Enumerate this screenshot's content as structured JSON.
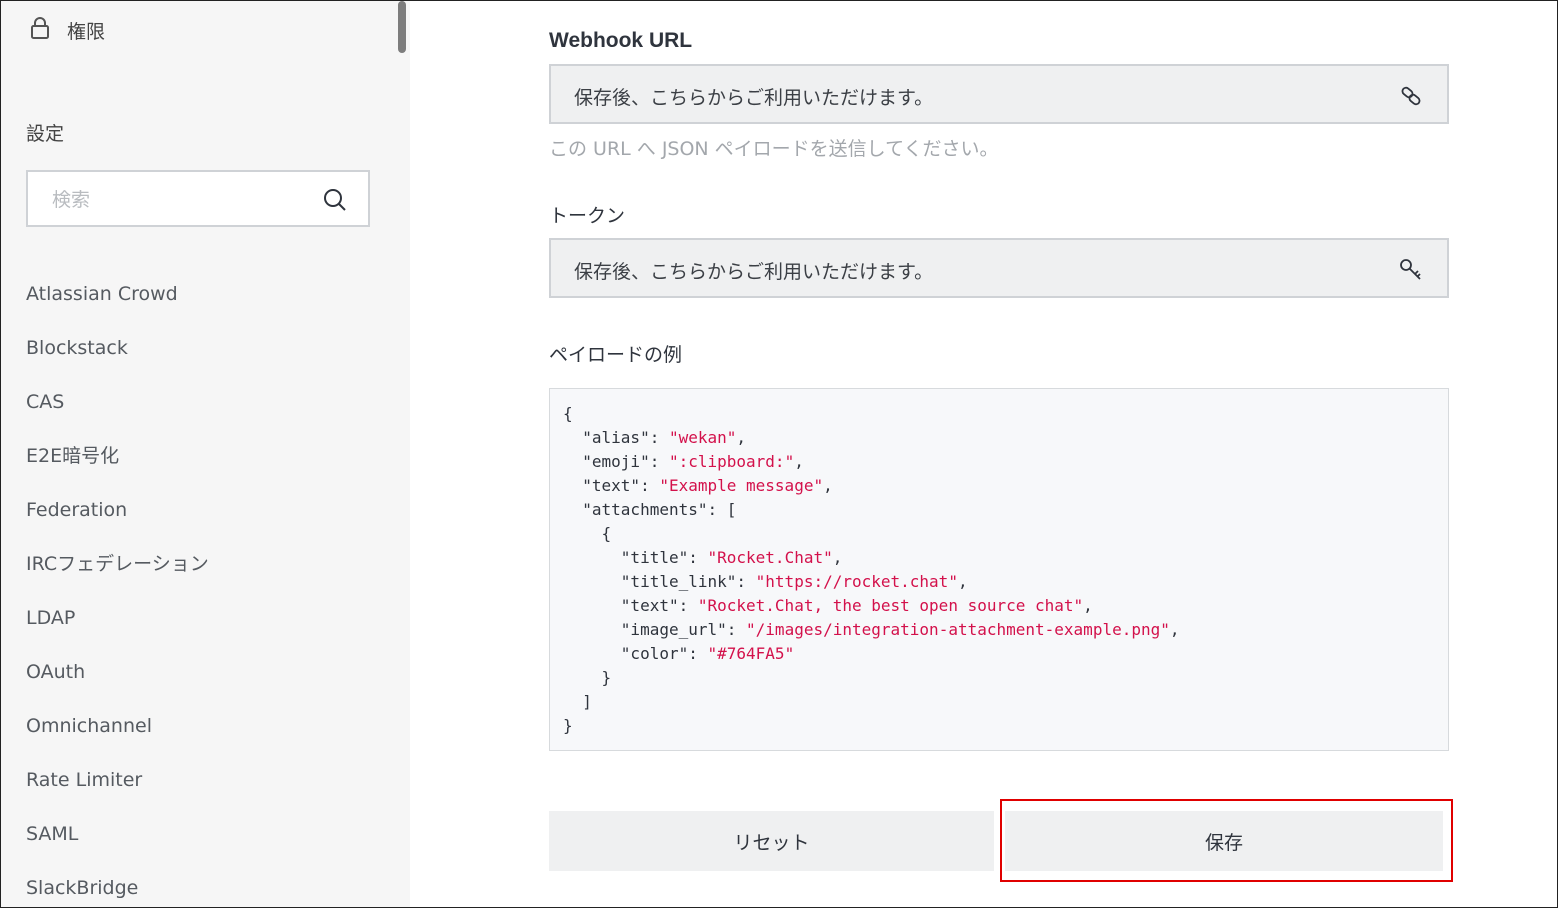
{
  "sidebar": {
    "permissions_label": "権限",
    "section_title": "設定",
    "search_placeholder": "検索",
    "items": [
      {
        "label": "Atlassian Crowd"
      },
      {
        "label": "Blockstack"
      },
      {
        "label": "CAS"
      },
      {
        "label": "E2E暗号化"
      },
      {
        "label": "Federation"
      },
      {
        "label": "IRCフェデレーション"
      },
      {
        "label": "LDAP"
      },
      {
        "label": "OAuth"
      },
      {
        "label": "Omnichannel"
      },
      {
        "label": "Rate Limiter"
      },
      {
        "label": "SAML"
      },
      {
        "label": "SlackBridge"
      }
    ]
  },
  "main": {
    "webhook_label": "Webhook URL",
    "webhook_value": "保存後、こちらからご利用いただけます。",
    "webhook_hint": "この URL へ JSON ペイロードを送信してください。",
    "token_label": "トークン",
    "token_value": "保存後、こちらからご利用いただけます。",
    "payload_label": "ペイロードの例",
    "payload_lines": [
      [
        {
          "t": "{"
        }
      ],
      [
        {
          "t": "  \"alias\": "
        },
        {
          "t": "\"wekan\"",
          "s": true
        },
        {
          "t": ","
        }
      ],
      [
        {
          "t": "  \"emoji\": "
        },
        {
          "t": "\":clipboard:\"",
          "s": true
        },
        {
          "t": ","
        }
      ],
      [
        {
          "t": "  \"text\": "
        },
        {
          "t": "\"Example message\"",
          "s": true
        },
        {
          "t": ","
        }
      ],
      [
        {
          "t": "  \"attachments\": ["
        }
      ],
      [
        {
          "t": "    {"
        }
      ],
      [
        {
          "t": "      \"title\": "
        },
        {
          "t": "\"Rocket.Chat\"",
          "s": true
        },
        {
          "t": ","
        }
      ],
      [
        {
          "t": "      \"title_link\": "
        },
        {
          "t": "\"https://rocket.chat\"",
          "s": true
        },
        {
          "t": ","
        }
      ],
      [
        {
          "t": "      \"text\": "
        },
        {
          "t": "\"Rocket.Chat, the best open source chat\"",
          "s": true
        },
        {
          "t": ","
        }
      ],
      [
        {
          "t": "      \"image_url\": "
        },
        {
          "t": "\"/images/integration-attachment-example.png\"",
          "s": true
        },
        {
          "t": ","
        }
      ],
      [
        {
          "t": "      \"color\": "
        },
        {
          "t": "\"#764FA5\"",
          "s": true
        }
      ],
      [
        {
          "t": "    }"
        }
      ],
      [
        {
          "t": "  ]"
        }
      ],
      [
        {
          "t": "}"
        }
      ]
    ],
    "reset_label": "リセット",
    "save_label": "保存"
  },
  "colors": {
    "string_literal": "#d3114b",
    "highlight_border": "#e00000"
  }
}
